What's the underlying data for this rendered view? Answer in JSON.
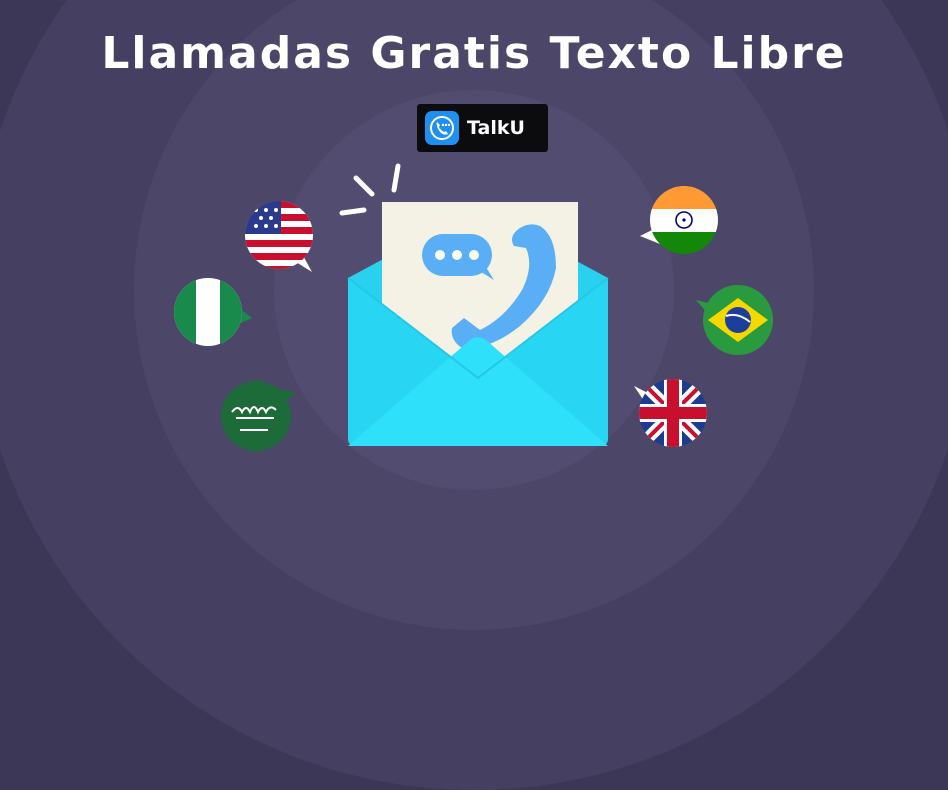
{
  "banner": {
    "title": "Llamadas Gratis Texto Libre",
    "brand_name": "TalkU"
  },
  "icons": [
    "phone-chat-icon",
    "chat-bubble-icon",
    "phone-handset-icon",
    "envelope-icon"
  ],
  "flags": [
    "usa-flag",
    "nigeria-flag",
    "saudi-arabia-flag",
    "india-flag",
    "brazil-flag",
    "uk-flag"
  ],
  "colors": {
    "background": "#3d3757",
    "envelope": "#2fd3f0",
    "letter": "#f4f2e4",
    "accent": "#5aaef5",
    "badge": "#0c0c0e",
    "brand_icon": "#1f8ff0"
  }
}
